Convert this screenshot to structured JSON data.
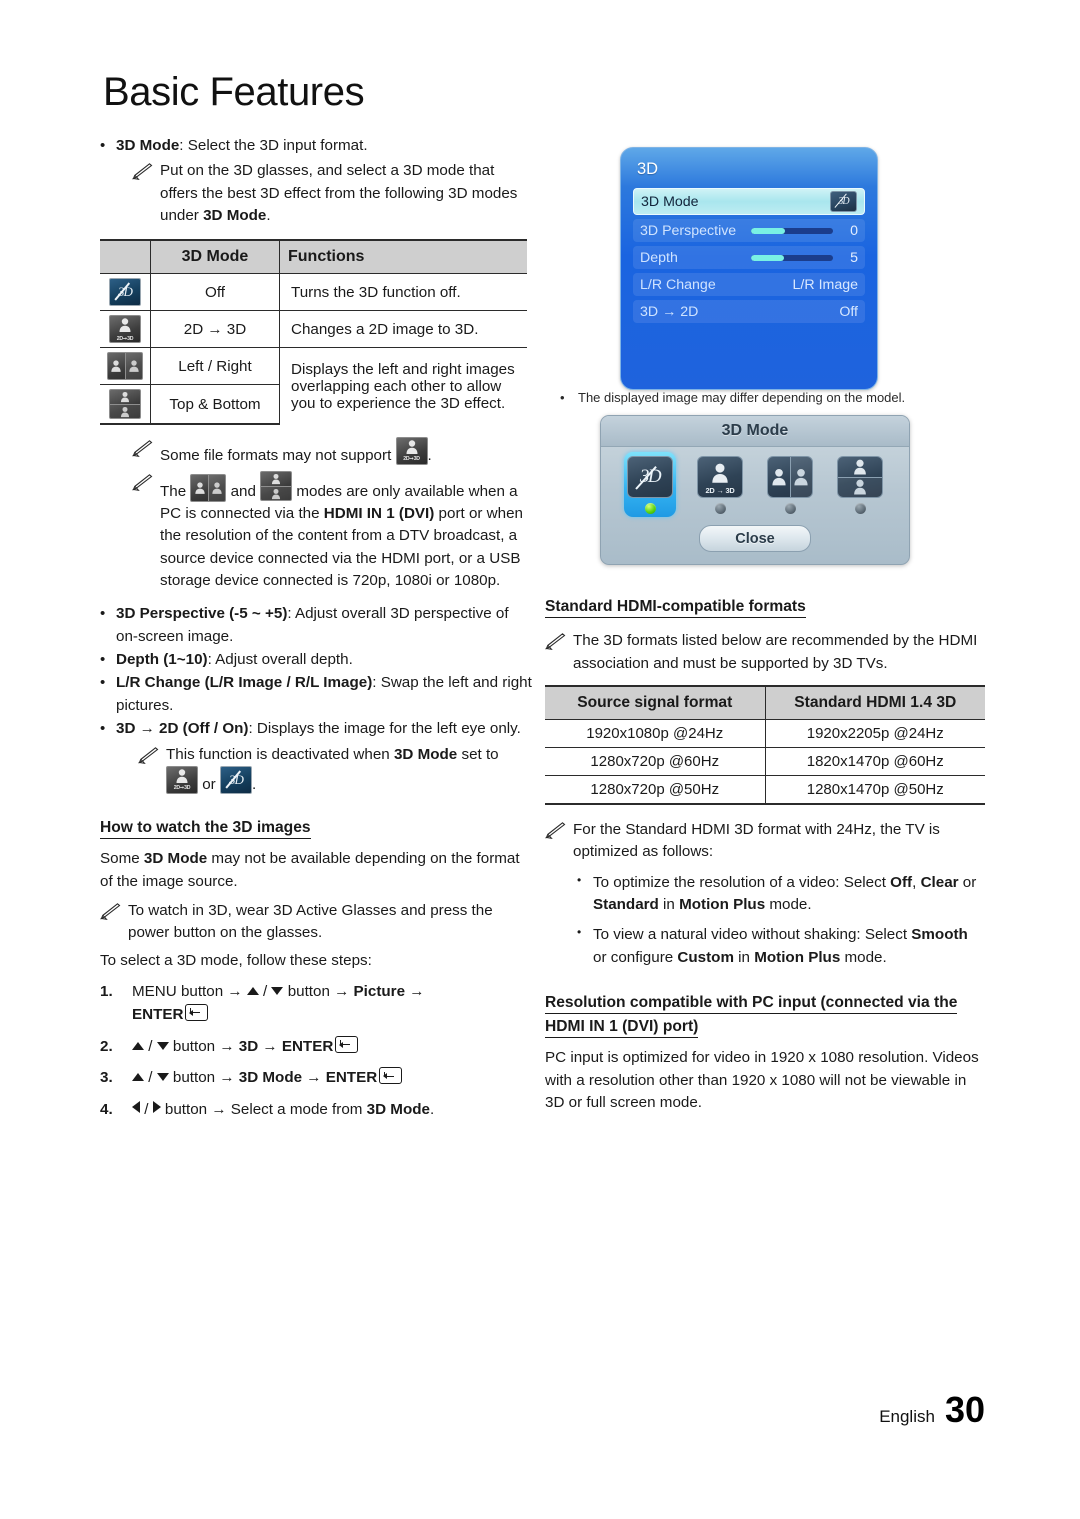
{
  "page": {
    "title": "Basic Features",
    "footer_language": "English",
    "footer_page": "30"
  },
  "left": {
    "mode_bullet": {
      "term": "3D Mode",
      "rest": ": Select the 3D input format."
    },
    "mode_note": "Put on the 3D glasses, and select a 3D mode that offers the best 3D effect from the following 3D modes under ",
    "mode_note_bold": "3D Mode",
    "mode_note_end": ".",
    "table": {
      "headers": [
        "3D Mode",
        "Functions"
      ],
      "rows": [
        {
          "icon": "3d-off-icon",
          "mode": "Off",
          "fn": "Turns the 3D function off."
        },
        {
          "icon": "2d-to-3d-icon",
          "mode": "2D → 3D",
          "fn": "Changes a 2D image to 3D."
        },
        {
          "icon": "left-right-icon",
          "mode": "Left / Right",
          "fn": "Displays the left and right images overlapping each other to allow you to experience the 3D effect."
        },
        {
          "icon": "top-bottom-icon",
          "mode": "Top & Bottom",
          "fn": ""
        }
      ]
    },
    "note_file_formats": "Some file formats may not support ",
    "note_file_formats_end": ".",
    "note_modes_pre": "The ",
    "note_modes_mid": " and ",
    "note_modes_post": " modes are only available when a PC is connected via the ",
    "note_modes_bold1": "HDMI IN 1 (DVI)",
    "note_modes_post2": " port or when the resolution of the content from a DTV broadcast, a source device connected via the HDMI port, or a USB storage device connected is 720p, 1080i or 1080p.",
    "bullets": [
      {
        "term": "3D Perspective (-5 ~ +5)",
        "rest": ": Adjust overall 3D perspective of on-screen image."
      },
      {
        "term": "Depth (1~10)",
        "rest": ": Adjust overall depth."
      },
      {
        "term": "L/R Change (L/R Image / R/L Image)",
        "rest": ": Swap the left and right pictures."
      },
      {
        "term": "3D → 2D (Off / On)",
        "rest": ": Displays the image for the left eye only."
      }
    ],
    "note_deactivated_pre": "This function is deactivated when ",
    "note_deactivated_bold": "3D Mode",
    "note_deactivated_post": " set to ",
    "note_deactivated_or": " or ",
    "note_deactivated_end": ".",
    "howto_heading": "How to watch the 3D images",
    "howto_p1_pre": "Some ",
    "howto_p1_bold": "3D Mode",
    "howto_p1_post": " may not be available depending on the format of the image source.",
    "howto_note": "To watch in 3D, wear 3D Active Glasses and press the power button on the glasses.",
    "howto_p2": "To select a 3D mode, follow these steps:",
    "steps": [
      {
        "num": "1.",
        "seg1": "MENU",
        "seg2": " button → ",
        "seg3": " / ",
        "seg4": " button → ",
        "seg5": "Picture",
        "seg6": " → ",
        "seg7": "ENTER"
      },
      {
        "num": "2.",
        "seg3": " / ",
        "seg4": " button → ",
        "seg5": "3D",
        "seg6": " → ",
        "seg7": "ENTER"
      },
      {
        "num": "3.",
        "seg3": " / ",
        "seg4": " button → ",
        "seg5": "3D Mode",
        "seg6": " → ",
        "seg7": "ENTER"
      },
      {
        "num": "4.",
        "seg3": " / ",
        "seg4": " button → Select a mode from ",
        "seg5": "3D Mode",
        "seg6": "."
      }
    ]
  },
  "osd": {
    "title": "3D",
    "rows": [
      {
        "label": "3D Mode",
        "value": "",
        "type": "badge"
      },
      {
        "label": "3D Perspective",
        "value": "0",
        "type": "slider",
        "fill_pct": 42
      },
      {
        "label": "Depth",
        "value": "5",
        "type": "slider",
        "fill_pct": 40
      },
      {
        "label": "L/R Change",
        "value": "L/R Image",
        "type": "text"
      },
      {
        "label": "3D → 2D",
        "value": "Off",
        "type": "text"
      }
    ]
  },
  "caption": "The displayed image may differ depending on the model.",
  "dialog": {
    "title": "3D Mode",
    "options": [
      {
        "name": "3d-off-option",
        "active": true
      },
      {
        "name": "2d-to-3d-option",
        "label": "2D → 3D",
        "active": false
      },
      {
        "name": "left-right-option",
        "active": false
      },
      {
        "name": "top-bottom-option",
        "active": false
      }
    ],
    "close_label": "Close"
  },
  "right": {
    "hdmi_heading": "Standard HDMI-compatible formats",
    "hdmi_note": "The 3D formats listed below are recommended by the HDMI association and must be supported by 3D TVs.",
    "hdmi_table": {
      "headers": [
        "Source signal format",
        "Standard HDMI 1.4 3D"
      ],
      "rows": [
        [
          "1920x1080p @24Hz",
          "1920x2205p @24Hz"
        ],
        [
          "1280x720p @60Hz",
          "1820x1470p @60Hz"
        ],
        [
          "1280x720p @50Hz",
          "1280x1470p @50Hz"
        ]
      ]
    },
    "note_24hz": "For the Standard HDMI 3D format with 24Hz, the TV is optimized as follows:",
    "sub_bullets": [
      {
        "pre": "To optimize the resolution of a video: Select ",
        "b1": "Off",
        "mid1": ", ",
        "b2": "Clear",
        "mid2": " or ",
        "b3": "Standard",
        "mid3": " in ",
        "b4": "Motion Plus",
        "post": " mode."
      },
      {
        "pre": "To view a natural video without shaking: Select ",
        "b1": "Smooth",
        "mid1": " or configure ",
        "b2": "Custom",
        "mid2": " in ",
        "b3": "Motion Plus",
        "post": " mode."
      }
    ],
    "pc_heading_1": "Resolution compatible with PC input (connected via the ",
    "pc_heading_bold": "HDMI IN 1 (DVI)",
    "pc_heading_2": " port)",
    "pc_body": "PC input is optimized for video in 1920 x 1080 resolution. Videos with a resolution other than 1920 x 1080 will not be viewable in 3D or full screen mode."
  },
  "colors": {
    "osd_blue": "#1a64e0",
    "osd_highlight": "#a9e6ee",
    "slider_fill": "#79f0e4",
    "table_header": "#cfcfcf",
    "led_active": "#5cd414"
  }
}
